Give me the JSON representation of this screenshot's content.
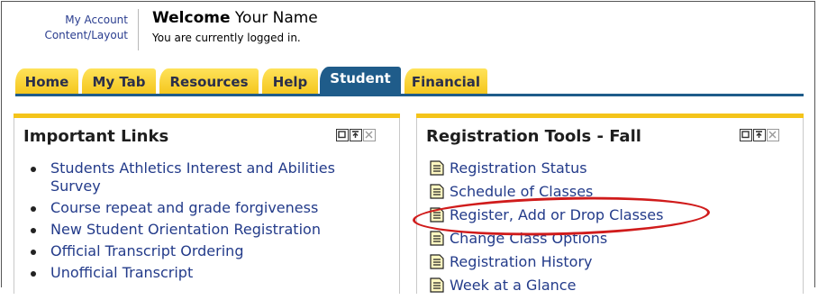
{
  "account": {
    "my_account": "My Account",
    "content_layout": "Content/Layout"
  },
  "header": {
    "welcome": "Welcome",
    "user_name": "Your Name",
    "status": "You are currently logged in."
  },
  "tabs": [
    {
      "label": "Home",
      "active": false
    },
    {
      "label": "My Tab",
      "active": false
    },
    {
      "label": "Resources",
      "active": false
    },
    {
      "label": "Help",
      "active": false
    },
    {
      "label": "Student",
      "active": true
    },
    {
      "label": "Financial",
      "active": false
    }
  ],
  "important_links": {
    "title": "Important Links",
    "items": [
      "Students Athletics Interest and Abilities Survey",
      "Course repeat and grade forgiveness",
      "New Student Orientation Registration",
      "Official Transcript Ordering",
      "Unofficial Transcript"
    ]
  },
  "registration_tools": {
    "title": "Registration Tools - Fall",
    "items": [
      "Registration Status",
      "Schedule of Classes",
      "Register, Add or Drop Classes",
      "Change Class Options",
      "Registration History",
      "Week at a Glance"
    ],
    "highlighted_item": "Register, Add or Drop Classes"
  },
  "colors": {
    "tab_yellow": "#f4c41a",
    "tab_active": "#1f5c8a",
    "link_blue": "#233b8a",
    "highlight_oval": "#d01b1b"
  },
  "icons": {
    "panel_controls": [
      "maximize-icon",
      "minimize-icon",
      "close-icon"
    ],
    "link_icon": "document-icon"
  }
}
